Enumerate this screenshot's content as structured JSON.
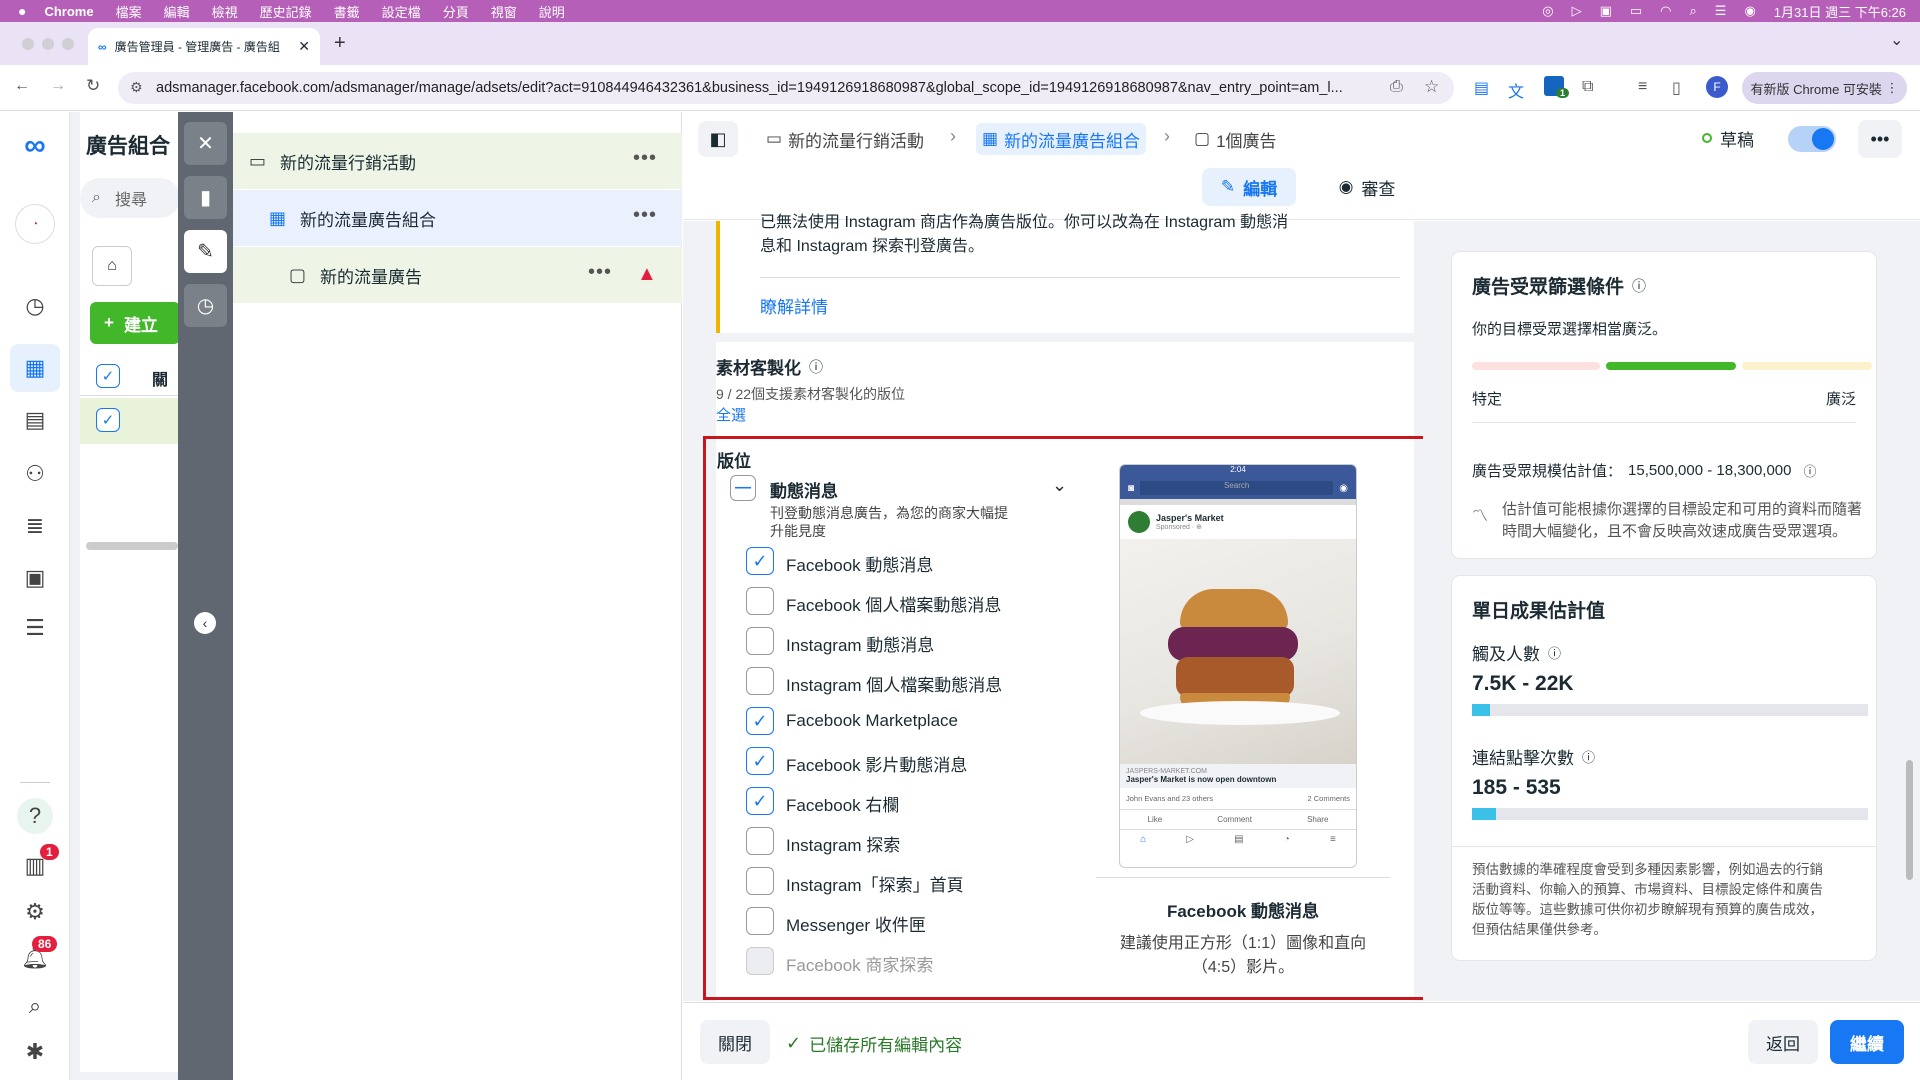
{
  "macbar": {
    "app": "Chrome",
    "menus": [
      "檔案",
      "編輯",
      "檢視",
      "歷史記錄",
      "書籤",
      "設定檔",
      "分頁",
      "視窗",
      "說明"
    ],
    "clock": "1月31日 週三 下午6:26"
  },
  "browser": {
    "tab_title": "廣告管理員 - 管理廣告 - 廣告組",
    "url": "adsmanager.facebook.com/adsmanager/manage/adsets/edit?act=910844946432361&business_id=1949126918680987&global_scope_id=1949126918680987&nav_entry_point=am_l...",
    "update_label": "有新版 Chrome 可安裝",
    "profile_initial": "F",
    "ext_badge": "1"
  },
  "rail": {
    "notification_badge": "1",
    "alerts_badge": "86"
  },
  "campaign_panel": {
    "title": "廣告組合",
    "search_placeholder": "搜尋",
    "create_label": "建立",
    "col_header": "關"
  },
  "tree": {
    "campaign": "新的流量行銷活動",
    "adset": "新的流量廣告組合",
    "ad": "新的流量廣告"
  },
  "header": {
    "crumb_campaign": "新的流量行銷活動",
    "crumb_adset": "新的流量廣告組合",
    "crumb_ad": "1個廣告",
    "status": "草稿",
    "tab_edit": "編輯",
    "tab_review": "審查"
  },
  "notice": {
    "text_line1": "已無法使用 Instagram 商店作為廣告版位。你可以改為在 Instagram 動態消",
    "text_line2": "息和 Instagram 探索刊登廣告。",
    "link": "瞭解詳情"
  },
  "customization": {
    "title": "素材客製化",
    "subtitle": "9 / 22個支援素材客製化的版位",
    "select_all": "全選"
  },
  "placements": {
    "title": "版位",
    "group_title": "動態消息",
    "group_desc_1": "刊登動態消息廣告，為您的商家大幅提",
    "group_desc_2": "升能見度",
    "items": [
      {
        "label": "Facebook 動態消息",
        "checked": true
      },
      {
        "label": "Facebook 個人檔案動態消息",
        "checked": false
      },
      {
        "label": "Instagram 動態消息",
        "checked": false
      },
      {
        "label": "Instagram 個人檔案動態消息",
        "checked": false
      },
      {
        "label": "Facebook Marketplace",
        "checked": true
      },
      {
        "label": "Facebook 影片動態消息",
        "checked": true
      },
      {
        "label": "Facebook 右欄",
        "checked": true
      },
      {
        "label": "Instagram 探索",
        "checked": false
      },
      {
        "label": "Instagram「探索」首頁",
        "checked": false
      },
      {
        "label": "Messenger 收件匣",
        "checked": false
      },
      {
        "label": "Facebook 商家探索",
        "checked": false
      }
    ],
    "preview": {
      "time": "2:04",
      "search": "Search",
      "page_name": "Jasper's Market",
      "sponsored": "Sponsored · ⊕",
      "link_domain": "JASPERS-MARKET.COM",
      "link_title": "Jasper's Market is now open downtown",
      "reactions": "John Evans and 23 others",
      "comments": "2 Comments",
      "like": "Like",
      "comment": "Comment",
      "share": "Share",
      "caption_title": "Facebook 動態消息",
      "caption_desc_1": "建議使用正方形（1:1）圖像和直向",
      "caption_desc_2": "（4:5）影片。"
    }
  },
  "audience": {
    "title": "廣告受眾篩選條件",
    "desc": "你的目標受眾選擇相當廣泛。",
    "label_left": "特定",
    "label_right": "廣泛",
    "size_label": "廣告受眾規模估計值：",
    "size_value": "15,500,000 - 18,300,000",
    "note_1": "估計值可能根據你選擇的目標設定和可用的資料而隨著",
    "note_2": "時間大幅變化，且不會反映高效速成廣告受眾選項。"
  },
  "daily": {
    "title": "單日成果估計值",
    "reach_label": "觸及人數",
    "reach_value": "7.5K - 22K",
    "clicks_label": "連結點擊次數",
    "clicks_value": "185 - 535",
    "note_1": "預估數據的準確程度會受到多種因素影響，例如過去的行銷",
    "note_2": "活動資料、你輸入的預算、市場資料、目標設定條件和廣告",
    "note_3": "版位等等。這些數據可供你初步瞭解現有預算的廣告成效，",
    "note_4": "但預估結果僅供參考。"
  },
  "footer": {
    "close": "關閉",
    "saved": "已儲存所有編輯內容",
    "back": "返回",
    "continue": "繼續"
  },
  "colors": {
    "accent": "#1877f2",
    "macbar": "#b55fb8",
    "warning": "#f0b400",
    "highlight": "#c8161d",
    "green": "#42b72a"
  }
}
